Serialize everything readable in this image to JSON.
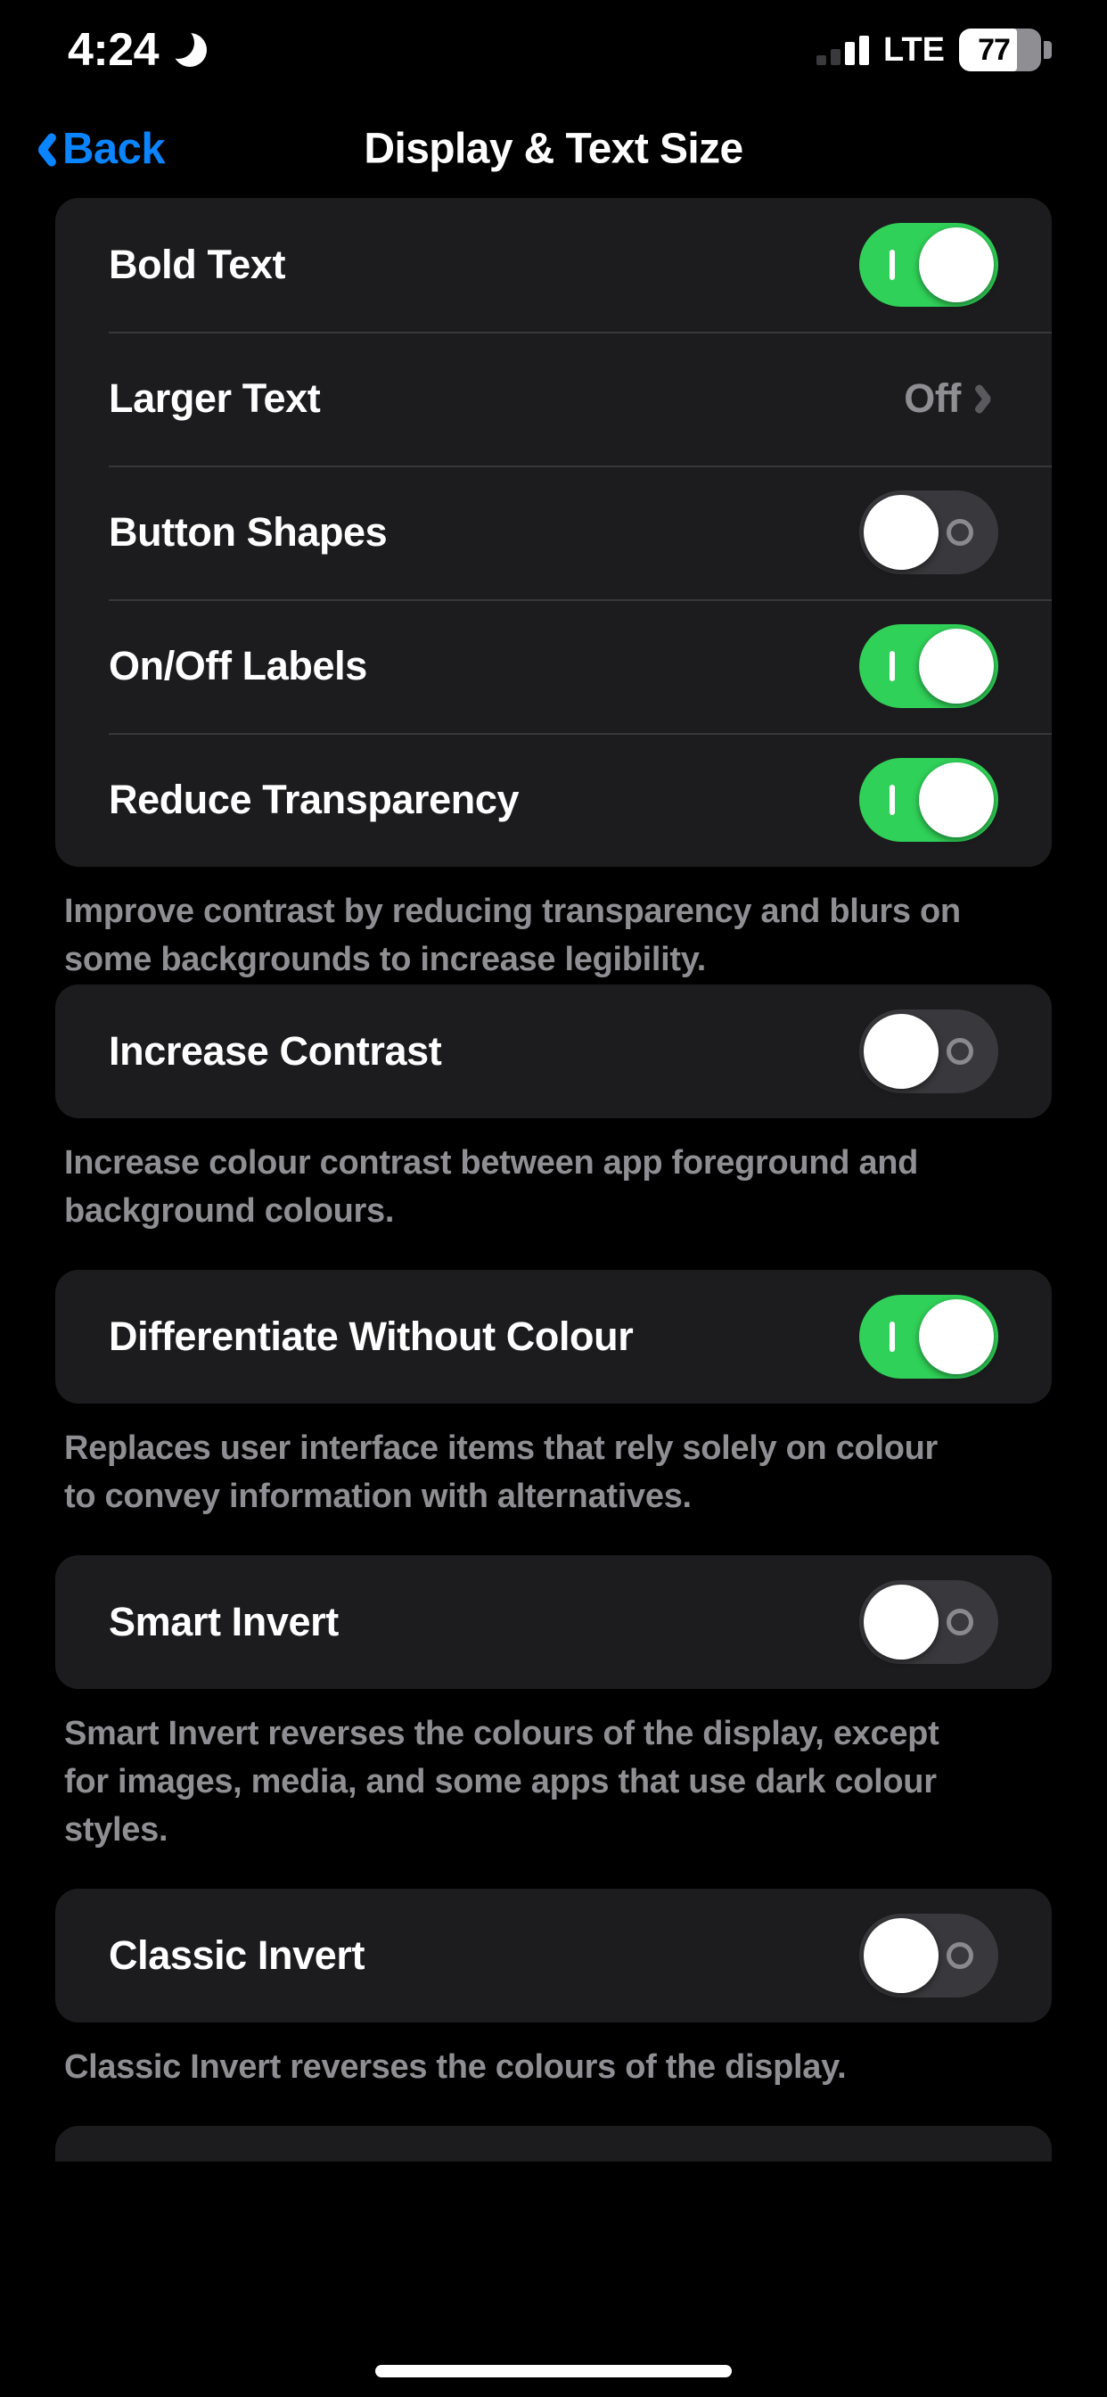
{
  "status_bar": {
    "time": "4:24",
    "moon_icon": "crescent-moon-icon",
    "signal_icon": "cellular-signal-icon",
    "signal_bars_active": 2,
    "signal_bars_total": 4,
    "network": "LTE",
    "battery_percent": "77",
    "battery_level": 77
  },
  "nav": {
    "back_label": "Back",
    "back_icon": "chevron-left-icon",
    "title": "Display & Text Size"
  },
  "groups": [
    {
      "rows": [
        {
          "label": "Bold Text",
          "type": "toggle",
          "state": "on"
        },
        {
          "label": "Larger Text",
          "type": "disclosure",
          "value": "Off",
          "icon": "chevron-right-icon"
        },
        {
          "label": "Button Shapes",
          "type": "toggle",
          "state": "off"
        },
        {
          "label": "On/Off Labels",
          "type": "toggle",
          "state": "on"
        },
        {
          "label": "Reduce Transparency",
          "type": "toggle",
          "state": "on"
        }
      ],
      "footer": "Improve contrast by reducing transparency and blurs on some backgrounds to increase legibility."
    },
    {
      "rows": [
        {
          "label": "Increase Contrast",
          "type": "toggle",
          "state": "off"
        }
      ],
      "footer": "Increase colour contrast between app foreground and background colours."
    },
    {
      "rows": [
        {
          "label": "Differentiate Without Colour",
          "type": "toggle",
          "state": "on"
        }
      ],
      "footer": "Replaces user interface items that rely solely on colour to convey information with alternatives."
    },
    {
      "rows": [
        {
          "label": "Smart Invert",
          "type": "toggle",
          "state": "off"
        }
      ],
      "footer": "Smart Invert reverses the colours of the display, except for images, media, and some apps that use dark colour styles."
    },
    {
      "rows": [
        {
          "label": "Classic Invert",
          "type": "toggle",
          "state": "off"
        }
      ],
      "footer": "Classic Invert reverses the colours of the display."
    }
  ],
  "colors": {
    "accent_blue": "#0A84FF",
    "toggle_on_green": "#30D158",
    "toggle_off_gray": "#39393D",
    "card_background": "#1C1C1E",
    "page_background": "#000000",
    "secondary_text": "#8E8E93",
    "separator": "#38383A"
  }
}
